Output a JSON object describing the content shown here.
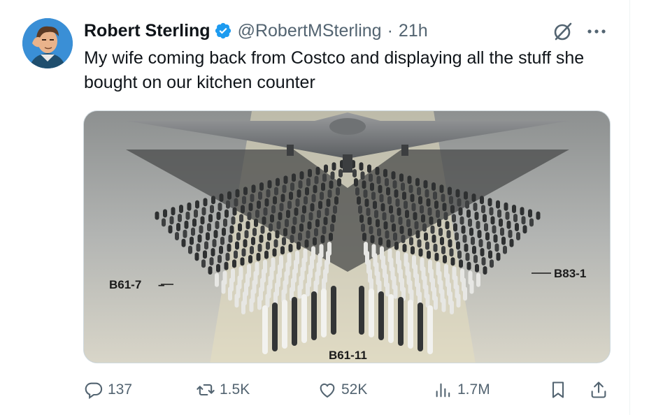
{
  "author": {
    "display_name": "Robert Sterling",
    "handle": "@RobertMSterling",
    "separator": "·",
    "time": "21h",
    "verified": true
  },
  "tweet": {
    "text": "My wife coming back from Costco and displaying all the stuff she bought on our kitchen counter"
  },
  "media": {
    "labels": {
      "left": "B61-7",
      "right": "B83-1",
      "center": "B61-11"
    }
  },
  "actions": {
    "replies": "137",
    "reposts": "1.5K",
    "likes": "52K",
    "views": "1.7M"
  },
  "colors": {
    "verified_blue": "#1d9bf0",
    "secondary_text": "#536471",
    "primary_text": "#0f1419"
  },
  "icons": [
    "verified-badge-icon",
    "grok-icon",
    "more-icon",
    "reply-icon",
    "repost-icon",
    "like-icon",
    "views-icon",
    "bookmark-icon",
    "share-icon"
  ]
}
